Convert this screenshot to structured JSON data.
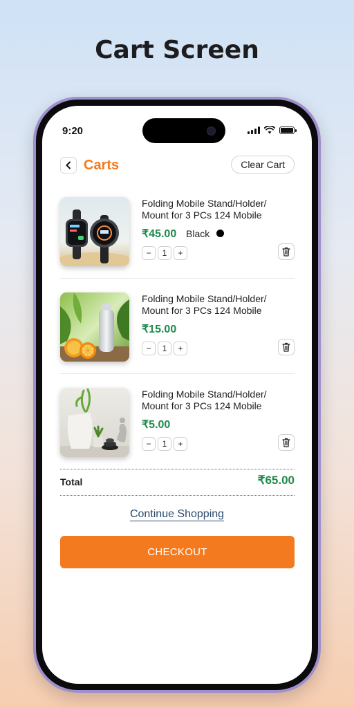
{
  "hero": {
    "title": "Cart Screen"
  },
  "status_bar": {
    "time": "9:20",
    "icons": [
      "signal-icon",
      "wifi-icon",
      "battery-icon"
    ]
  },
  "header": {
    "back_icon": "chevron-left-icon",
    "title": "Carts",
    "clear_label": "Clear Cart"
  },
  "items": [
    {
      "name": "Folding Mobile Stand/Holder/ Mount for 3 PCs 124 Mobile",
      "price": "₹45.00",
      "color_label": "Black",
      "color_hex": "#000000",
      "quantity": "1",
      "image": "smartwatches"
    },
    {
      "name": "Folding Mobile Stand/Holder/ Mount for 3 PCs 124 Mobile",
      "price": "₹15.00",
      "quantity": "1",
      "image": "bottle-with-oranges"
    },
    {
      "name": "Folding Mobile Stand/Holder/ Mount for 3 PCs 124 Mobile",
      "price": "₹5.00",
      "quantity": "1",
      "image": "vase-with-plants"
    }
  ],
  "stepper": {
    "minus": "−",
    "plus": "+"
  },
  "total": {
    "label": "Total",
    "value": "₹65.00"
  },
  "actions": {
    "continue_label": "Continue Shopping",
    "checkout_label": "CHECKOUT"
  },
  "colors": {
    "accent": "#f47a1f",
    "price": "#1f8a4c",
    "phone_frame": "#9f8fcc"
  }
}
